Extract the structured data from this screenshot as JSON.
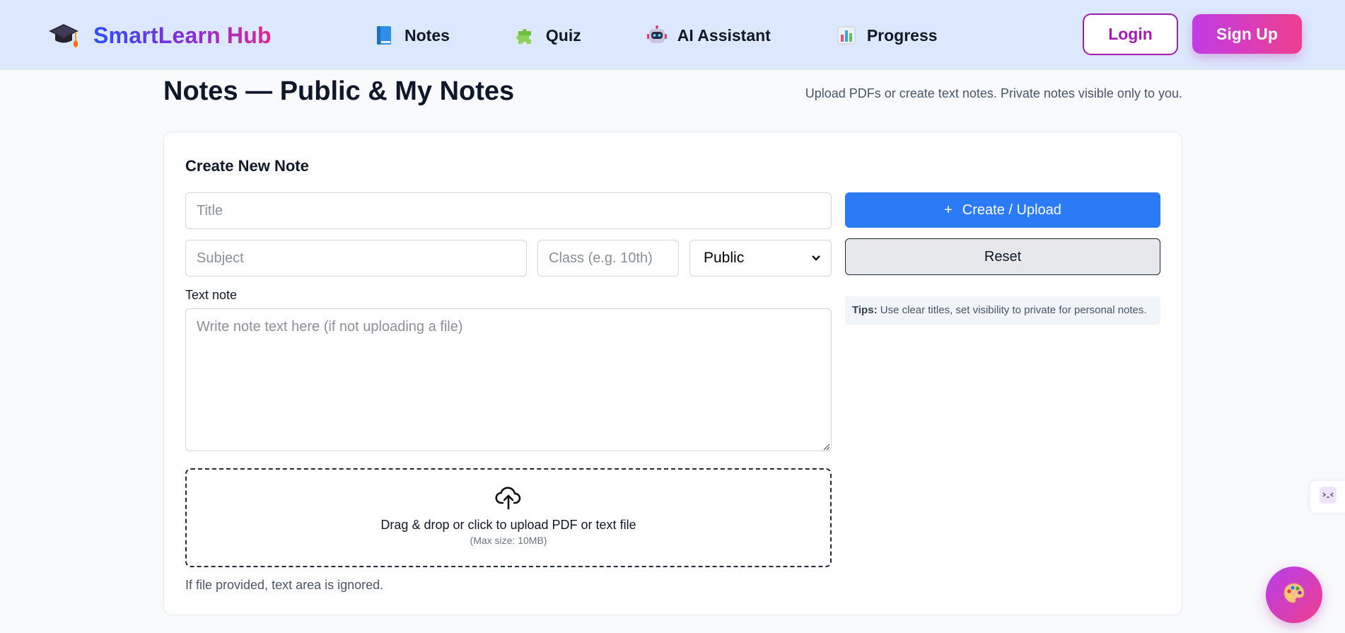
{
  "header": {
    "brand": {
      "name": "SmartLearn Hub",
      "icon": "graduation-cap-icon"
    },
    "nav": [
      {
        "label": "Notes",
        "icon": "blue-book-icon"
      },
      {
        "label": "Quiz",
        "icon": "puzzle-piece-icon"
      },
      {
        "label": "AI Assistant",
        "icon": "robot-icon"
      },
      {
        "label": "Progress",
        "icon": "bar-chart-icon"
      }
    ],
    "login_label": "Login",
    "signup_label": "Sign Up"
  },
  "page": {
    "title": "Notes — Public & My Notes",
    "subtitle": "Upload PDFs or create text notes. Private notes visible only to you."
  },
  "form": {
    "heading": "Create New Note",
    "title_placeholder": "Title",
    "subject_placeholder": "Subject",
    "class_placeholder": "Class (e.g. 10th)",
    "visibility": {
      "selected": "Public"
    },
    "text_label": "Text note",
    "text_placeholder": "Write note text here (if not uploading a file)",
    "dropzone": {
      "text": "Drag & drop or click to upload PDF or text file",
      "hint": "(Max size: 10MB)",
      "icon": "cloud-upload-icon"
    },
    "file_note": "If file provided, text area is ignored.",
    "create_label": "Create / Upload",
    "create_prefix": "+",
    "reset_label": "Reset",
    "tips_label": "Tips:",
    "tips_text": " Use clear titles, set visibility to private for personal notes."
  },
  "floating": {
    "side_tab_icon": "tool-drawer-icon",
    "fab_icon": "palette-icon"
  },
  "colors": {
    "header_bg": "#dbe8fd",
    "primary": "#2b7bf7",
    "accent_purple": "#a21caf",
    "accent_pink": "#ee3f8e"
  }
}
